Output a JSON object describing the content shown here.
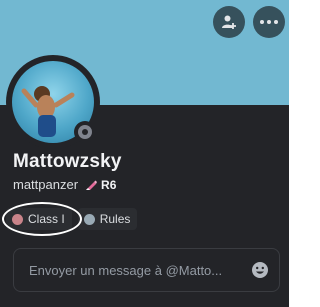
{
  "profile": {
    "display_name": "Mattowzsky",
    "username": "mattpanzer",
    "tag": "R6",
    "status": "offline"
  },
  "roles": [
    {
      "label": "Class I",
      "color": "#c9848a"
    },
    {
      "label": "Rules",
      "color": "#99aab5"
    }
  ],
  "message": {
    "placeholder": "Envoyer un message à @Matto..."
  },
  "colors": {
    "banner": "#72b8d1",
    "card": "#232428",
    "status_offline": "#80848e"
  },
  "icons": {
    "add_friend": "add-friend-icon",
    "more": "more-options-icon",
    "tag": "pen-tag-icon",
    "emoji": "emoji-icon"
  }
}
